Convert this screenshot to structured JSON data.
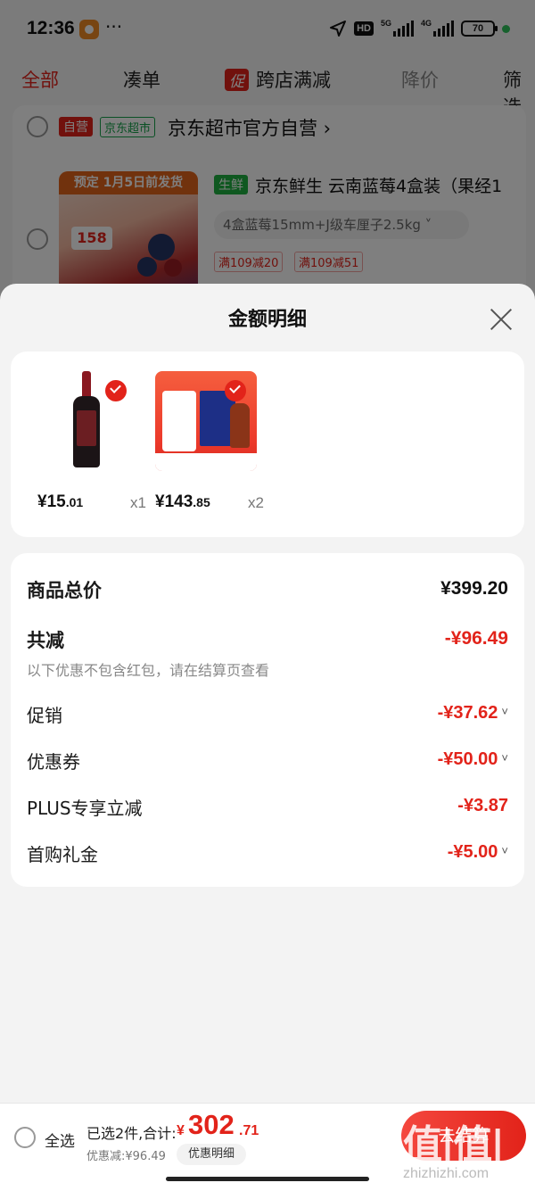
{
  "status_bar": {
    "time": "12:36",
    "dots": "···",
    "hd": "HD",
    "net1": "5G",
    "net2": "4G",
    "battery": "70"
  },
  "top_tabs": [
    "全部",
    "凑单",
    "跨店满减",
    "降价",
    "筛选"
  ],
  "top_tabs_promo_tag": "促",
  "store": {
    "self_tag": "自营",
    "market_tag": "京东超市",
    "name": "京东超市官方自营 ›",
    "product": {
      "banner": "预定 1月5日前发货",
      "thumb_price": "158",
      "fresh_tag": "生鲜",
      "title": "京东鲜生 云南蓝莓4盒装（果经1",
      "spec": "4盒蓝莓15mm+J级车厘子2.5kg ˅",
      "offers": [
        "满109减20",
        "满109减51"
      ]
    }
  },
  "sheet": {
    "title": "金额明细",
    "items": [
      {
        "name": "wine",
        "currency": "¥",
        "price_int": "15",
        "price_dec": ".01",
        "qty": "x1"
      },
      {
        "name": "gift-box",
        "currency": "¥",
        "price_int": "143",
        "price_dec": ".85",
        "qty": "x2"
      }
    ],
    "totals": {
      "goods_total_label": "商品总价",
      "goods_total_value": "¥399.20",
      "total_reduce_label": "共减",
      "total_reduce_value": "-¥96.49",
      "note": "以下优惠不包含红包，请在结算页查看",
      "rows": [
        {
          "label": "促销",
          "value": "-¥37.62",
          "chevron": "˅"
        },
        {
          "label": "优惠券",
          "value": "-¥50.00",
          "chevron": "˅"
        },
        {
          "label": "PLUS专享立减",
          "value": "-¥3.87",
          "chevron": ""
        },
        {
          "label": "首购礼金",
          "value": "-¥5.00",
          "chevron": "˅"
        }
      ]
    }
  },
  "bottom_bar": {
    "select_all": "全选",
    "summary": "已选2件,合计:",
    "currency": "¥",
    "total_int": "302",
    "total_dec": ".71",
    "discount": "优惠减:¥96.49",
    "detail_button": "优惠明细",
    "checkout": "去结算",
    "watermark": "值|值|值",
    "watermark_url": "zhizhizhi.com"
  },
  "colors": {
    "accent": "#e2231a",
    "fresh_green": "#1eb040",
    "sheet_bg": "#f3f3f3"
  }
}
